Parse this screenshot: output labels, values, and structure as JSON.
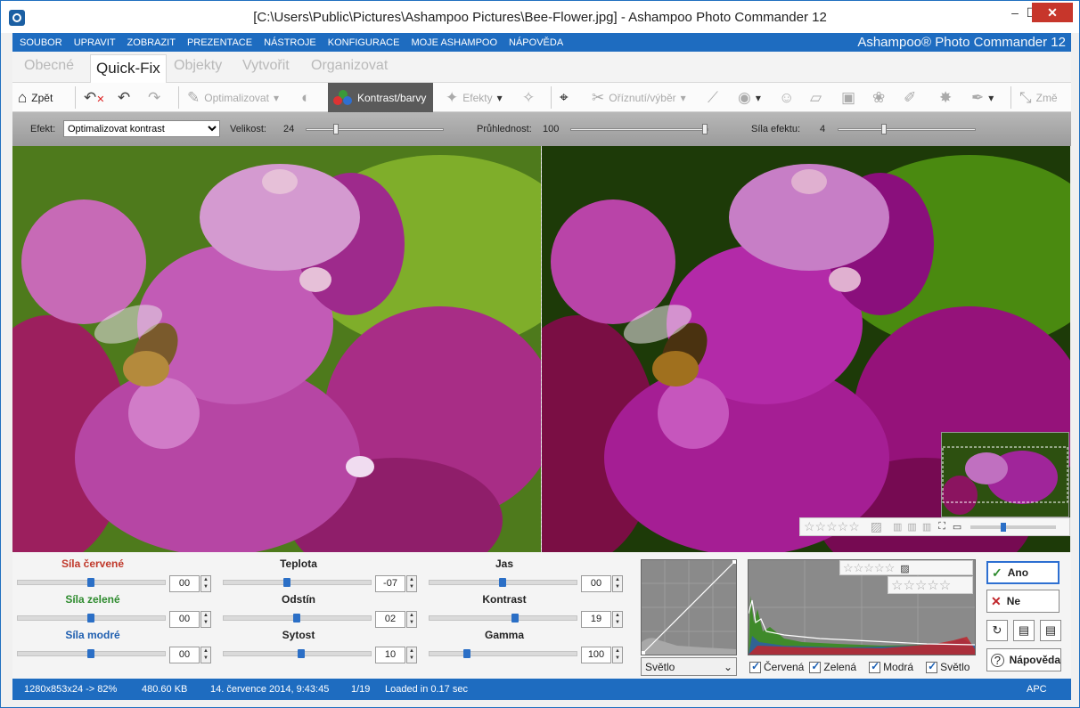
{
  "window": {
    "title": "[C:\\Users\\Public\\Pictures\\Ashampoo Pictures\\Bee-Flower.jpg] - Ashampoo Photo Commander 12",
    "min": "–",
    "max": "☐",
    "close": "✕"
  },
  "menu": {
    "items": [
      "SOUBOR",
      "UPRAVIT",
      "ZOBRAZIT",
      "PREZENTACE",
      "NÁSTROJE",
      "KONFIGURACE",
      "MOJE ASHAMPOO",
      "NÁPOVĚDA"
    ],
    "brand": "Ashampoo® Photo Commander 12"
  },
  "tabs": [
    "Obecné",
    "Quick-Fix",
    "Objekty",
    "Vytvořit",
    "Organizovat"
  ],
  "toolbar": {
    "back": "Zpět",
    "optimize": "Optimalizovat",
    "contrast": "Kontrast/barvy",
    "effects": "Efekty",
    "crop": "Oříznutí/výběr",
    "resize": "Změ"
  },
  "effect": {
    "label": "Efekt:",
    "selected": "Optimalizovat kontrast",
    "size_label": "Velikost:",
    "size": "24",
    "transparency_label": "Průhlednost:",
    "transparency": "100",
    "strength_label": "Síla efektu:",
    "strength": "4"
  },
  "view": {
    "stars": "☆☆☆☆☆"
  },
  "sliders": [
    {
      "title": "Síla červené",
      "value": "00",
      "color": "#c0392b"
    },
    {
      "title": "Teplota",
      "value": "-07",
      "color": "#222222"
    },
    {
      "title": "Jas",
      "value": "00",
      "color": "#222222"
    },
    {
      "title": "Síla zelené",
      "value": "00",
      "color": "#2e8b2e"
    },
    {
      "title": "Odstín",
      "value": "02",
      "color": "#222222"
    },
    {
      "title": "Kontrast",
      "value": "19",
      "color": "#222222"
    },
    {
      "title": "Síla modré",
      "value": "00",
      "color": "#1f5fb0"
    },
    {
      "title": "Sytost",
      "value": "10",
      "color": "#222222"
    },
    {
      "title": "Gamma",
      "value": "100",
      "color": "#222222"
    }
  ],
  "curve": {
    "channel": "Světlo"
  },
  "histogram": {
    "checks": [
      "Červená",
      "Zelená",
      "Modrá",
      "Světlo"
    ]
  },
  "buttons": {
    "yes": "Ano",
    "no": "Ne",
    "help": "Nápověda"
  },
  "status": {
    "dims": "1280x853x24 -> 82%",
    "size": "480.60 KB",
    "date": "14. července 2014, 9:43:45",
    "page": "1/19",
    "loaded": "Loaded in 0.17 sec",
    "mode": "APC"
  }
}
